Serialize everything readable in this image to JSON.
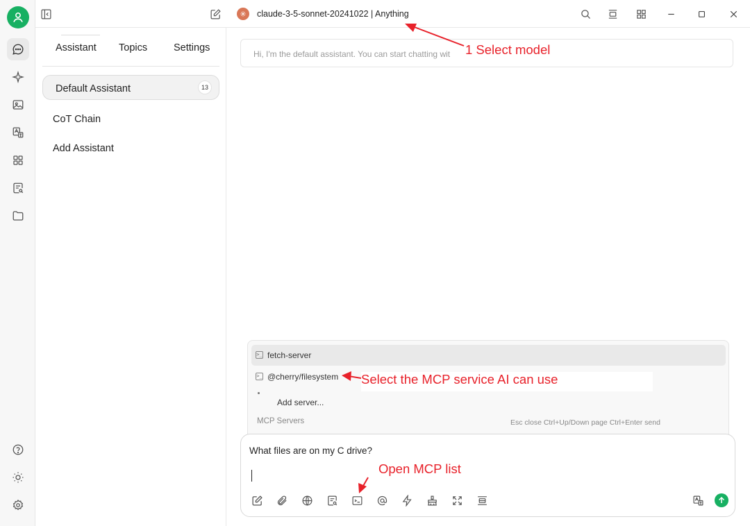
{
  "title_bar": {
    "model_title": "claude-3-5-sonnet-20241022 | Anything"
  },
  "sidebar": {
    "tabs": [
      {
        "label": "Assistant"
      },
      {
        "label": "Topics"
      },
      {
        "label": "Settings"
      }
    ],
    "assistants": [
      {
        "label": "Default Assistant",
        "count": "13",
        "selected": true
      },
      {
        "label": "CoT Chain"
      },
      {
        "label": "Add Assistant"
      }
    ]
  },
  "chat": {
    "greeting": "Hi, I'm the default assistant. You can start chatting wit"
  },
  "mcp_popup": {
    "servers": [
      {
        "label": "fetch-server",
        "icon": "terminal-icon"
      },
      {
        "label": "@cherry/filesystem",
        "icon": "terminal-icon"
      }
    ],
    "add_server": "Add server...",
    "section_label": "MCP Servers",
    "hint": "Esc close Ctrl+Up/Down page Ctrl+Enter send"
  },
  "input": {
    "value": "What files are on my C drive?"
  },
  "annotations": {
    "select_model": "1 Select model",
    "select_mcp": "Select the MCP service AI can use",
    "open_mcp": "Open MCP list"
  },
  "colors": {
    "accent": "#17b062",
    "annotation": "#e8212a",
    "model_logo": "#d97757"
  }
}
